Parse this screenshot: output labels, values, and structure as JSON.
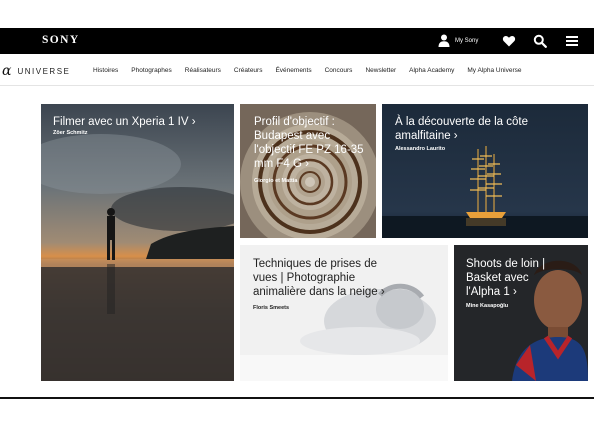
{
  "header": {
    "logo": "SONY",
    "my_sony": "My Sony",
    "icons": [
      "user-icon",
      "heart-icon",
      "search-icon",
      "menu-icon"
    ]
  },
  "nav": {
    "brand_symbol": "α",
    "brand_name": "UNIVERSE",
    "items": [
      "Histoires",
      "Photographes",
      "Réalisateurs",
      "Créateurs",
      "Événements",
      "Concours",
      "Newsletter",
      "Alpha Academy",
      "My Alpha Universe"
    ]
  },
  "tiles": [
    {
      "title": "Filmer avec un Xperia 1 IV ›",
      "author": "Zöer Schmitz"
    },
    {
      "title": "Profil d'objectif : Budapest avec l'objectif FE PZ 16-35 mm F4 G ›",
      "author": "Giorgio et Mattia"
    },
    {
      "title": "À la découverte de la côte amalfitaine ›",
      "author": "Alessandro Laurito"
    },
    {
      "title": "Techniques de prises de vues | Photographie animalière dans la neige ›",
      "author": "Floris Smeets"
    },
    {
      "title": "Shoots de loin | Basket avec l'Alpha 1 ›",
      "author": "Mine Kasapoğlu"
    }
  ]
}
